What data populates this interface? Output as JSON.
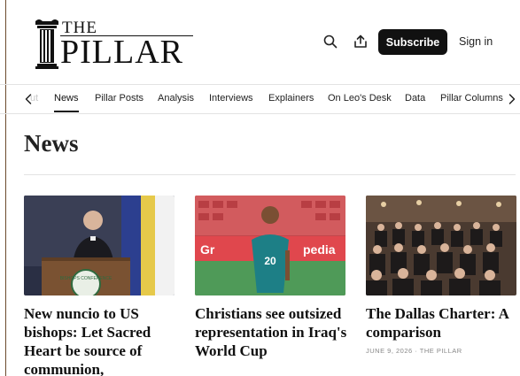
{
  "logo": {
    "line1": "THE",
    "line2": "PILLAR"
  },
  "header": {
    "subscribe_label": "Subscribe",
    "signin_label": "Sign in"
  },
  "nav": {
    "items": [
      {
        "label": "ut"
      },
      {
        "label": "News"
      },
      {
        "label": "Pillar Posts"
      },
      {
        "label": "Analysis"
      },
      {
        "label": "Interviews"
      },
      {
        "label": "Explainers"
      },
      {
        "label": "On Leo's Desk"
      },
      {
        "label": "Data"
      },
      {
        "label": "Pillar Columns"
      }
    ],
    "active": "News"
  },
  "section": {
    "title": "News"
  },
  "cards": [
    {
      "title": "New nuncio to US bishops: Let Sacred Heart be source of communion,",
      "podium_text": "BISHOPS CONFERENCE"
    },
    {
      "title": "Christians see outsized representation in Iraq's World Cup",
      "banner_text": "Gr",
      "banner_text2": "pedia",
      "jersey_number": "20"
    },
    {
      "title": "The Dallas Charter: A comparison",
      "date": "JUNE 9, 2026",
      "author": "THE PILLAR"
    }
  ],
  "colors": {
    "accent": "#111111",
    "text": "#111111",
    "muted": "#888888",
    "rule": "#e3e3e3"
  }
}
